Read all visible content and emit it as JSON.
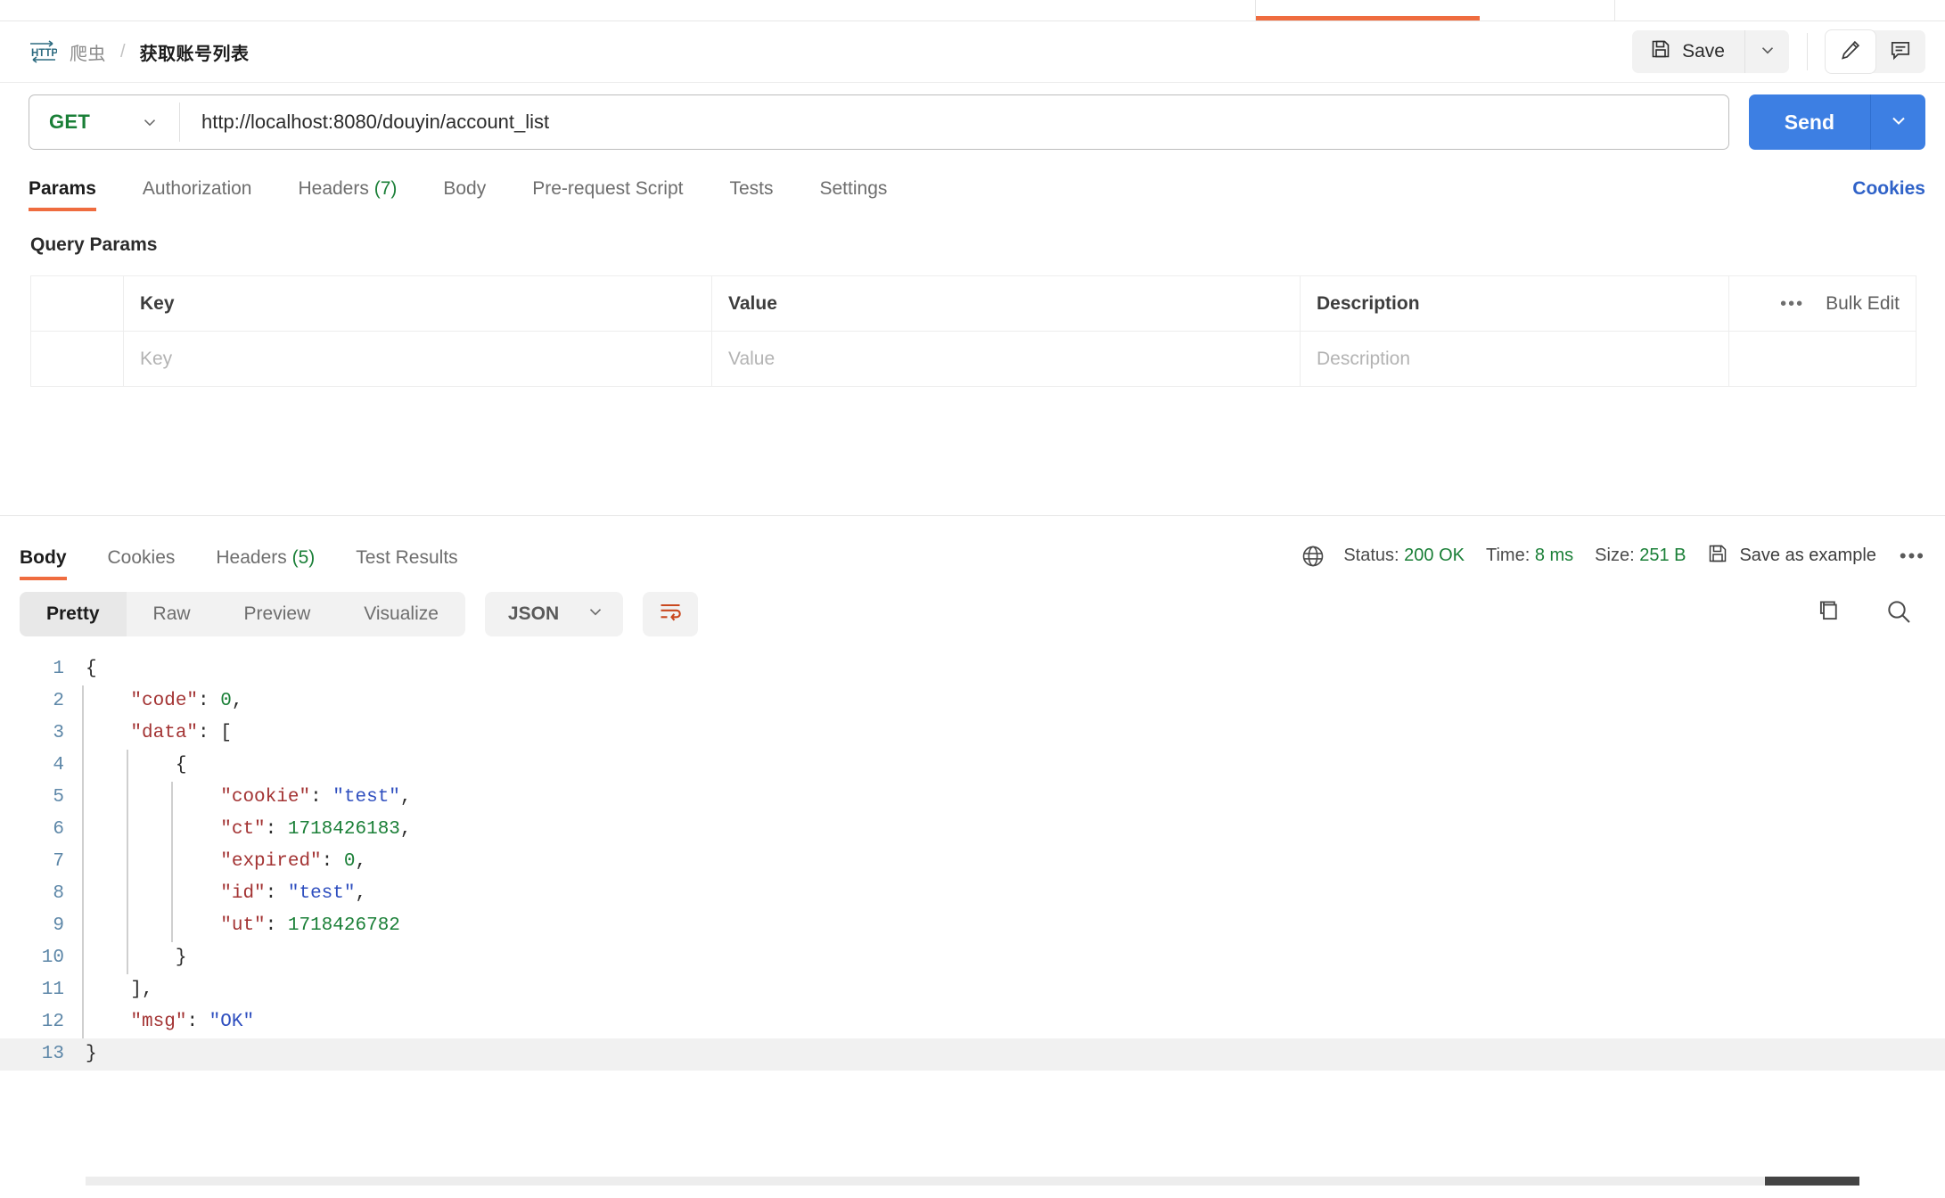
{
  "window": {
    "tabstrip": {
      "active_tab_indicator_color": "#ef6c3f"
    }
  },
  "request_header": {
    "protocol_icon": "http-icon",
    "breadcrumb_parent": "爬虫",
    "breadcrumb_separator": "/",
    "breadcrumb_current": "获取账号列表",
    "save_label": "Save",
    "save_caret": "chevron-down-icon",
    "edit_icon": "pencil-icon",
    "comment_icon": "comment-icon"
  },
  "url_bar": {
    "method": "GET",
    "method_color": "#1a7f37",
    "url": "http://localhost:8080/douyin/account_list",
    "send_label": "Send",
    "send_color": "#3d7fe3"
  },
  "request_tabs": {
    "items": [
      {
        "label": "Params",
        "count": "",
        "active": true
      },
      {
        "label": "Authorization",
        "count": "",
        "active": false
      },
      {
        "label": "Headers",
        "count": "(7)",
        "active": false
      },
      {
        "label": "Body",
        "count": "",
        "active": false
      },
      {
        "label": "Pre-request Script",
        "count": "",
        "active": false
      },
      {
        "label": "Tests",
        "count": "",
        "active": false
      },
      {
        "label": "Settings",
        "count": "",
        "active": false
      }
    ],
    "cookies_link": "Cookies"
  },
  "query_params": {
    "section_title": "Query Params",
    "columns": [
      "Key",
      "Value",
      "Description"
    ],
    "rows": [
      {
        "key_placeholder": "Key",
        "value_placeholder": "Value",
        "description_placeholder": "Description"
      }
    ],
    "options_icon": "ellipsis-icon",
    "bulk_edit_label": "Bulk Edit"
  },
  "response": {
    "tabs": [
      {
        "label": "Body",
        "count": "",
        "active": true
      },
      {
        "label": "Cookies",
        "count": "",
        "active": false
      },
      {
        "label": "Headers",
        "count": "(5)",
        "active": false
      },
      {
        "label": "Test Results",
        "count": "",
        "active": false
      }
    ],
    "globe_icon": "globe-icon",
    "status_label": "Status:",
    "status_value": "200 OK",
    "time_label": "Time:",
    "time_value": "8 ms",
    "size_label": "Size:",
    "size_value": "251 B",
    "save_example_label": "Save as example",
    "save_example_icon": "floppy-icon",
    "more_icon": "ellipsis-icon",
    "status_color": "#1a7f37"
  },
  "body_toolbar": {
    "view_modes": [
      {
        "label": "Pretty",
        "active": true
      },
      {
        "label": "Raw",
        "active": false
      },
      {
        "label": "Preview",
        "active": false
      },
      {
        "label": "Visualize",
        "active": false
      }
    ],
    "format": "JSON",
    "format_caret": "chevron-down-icon",
    "wrap_icon": "word-wrap-icon",
    "wrap_active_color": "#c9481f",
    "copy_icon": "copy-icon",
    "search_icon": "search-icon"
  },
  "json_body": {
    "lines": [
      {
        "n": "1",
        "indent": 0,
        "tokens": [
          {
            "t": "punc",
            "v": "{"
          }
        ]
      },
      {
        "n": "2",
        "indent": 1,
        "tokens": [
          {
            "t": "key",
            "v": "\"code\""
          },
          {
            "t": "punc",
            "v": ": "
          },
          {
            "t": "num",
            "v": "0"
          },
          {
            "t": "punc",
            "v": ","
          }
        ]
      },
      {
        "n": "3",
        "indent": 1,
        "tokens": [
          {
            "t": "key",
            "v": "\"data\""
          },
          {
            "t": "punc",
            "v": ": ["
          }
        ]
      },
      {
        "n": "4",
        "indent": 2,
        "tokens": [
          {
            "t": "punc",
            "v": "{"
          }
        ]
      },
      {
        "n": "5",
        "indent": 3,
        "tokens": [
          {
            "t": "key",
            "v": "\"cookie\""
          },
          {
            "t": "punc",
            "v": ": "
          },
          {
            "t": "str",
            "v": "\"test\""
          },
          {
            "t": "punc",
            "v": ","
          }
        ]
      },
      {
        "n": "6",
        "indent": 3,
        "tokens": [
          {
            "t": "key",
            "v": "\"ct\""
          },
          {
            "t": "punc",
            "v": ": "
          },
          {
            "t": "num",
            "v": "1718426183"
          },
          {
            "t": "punc",
            "v": ","
          }
        ]
      },
      {
        "n": "7",
        "indent": 3,
        "tokens": [
          {
            "t": "key",
            "v": "\"expired\""
          },
          {
            "t": "punc",
            "v": ": "
          },
          {
            "t": "num",
            "v": "0"
          },
          {
            "t": "punc",
            "v": ","
          }
        ]
      },
      {
        "n": "8",
        "indent": 3,
        "tokens": [
          {
            "t": "key",
            "v": "\"id\""
          },
          {
            "t": "punc",
            "v": ": "
          },
          {
            "t": "str",
            "v": "\"test\""
          },
          {
            "t": "punc",
            "v": ","
          }
        ]
      },
      {
        "n": "9",
        "indent": 3,
        "tokens": [
          {
            "t": "key",
            "v": "\"ut\""
          },
          {
            "t": "punc",
            "v": ": "
          },
          {
            "t": "num",
            "v": "1718426782"
          }
        ]
      },
      {
        "n": "10",
        "indent": 2,
        "tokens": [
          {
            "t": "punc",
            "v": "}"
          }
        ]
      },
      {
        "n": "11",
        "indent": 1,
        "tokens": [
          {
            "t": "punc",
            "v": "],"
          }
        ]
      },
      {
        "n": "12",
        "indent": 1,
        "tokens": [
          {
            "t": "key",
            "v": "\"msg\""
          },
          {
            "t": "punc",
            "v": ": "
          },
          {
            "t": "str",
            "v": "\"OK\""
          }
        ]
      },
      {
        "n": "13",
        "indent": 0,
        "tokens": [
          {
            "t": "punc",
            "v": "}"
          }
        ],
        "current": true
      }
    ],
    "raw": "{\n    \"code\": 0,\n    \"data\": [\n        {\n            \"cookie\": \"test\",\n            \"ct\": 1718426183,\n            \"expired\": 0,\n            \"id\": \"test\",\n            \"ut\": 1718426782\n        }\n    ],\n    \"msg\": \"OK\"\n}"
  }
}
